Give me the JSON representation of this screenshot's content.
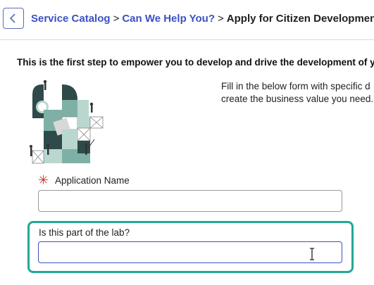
{
  "header": {
    "back_icon": "chevron-left-icon",
    "breadcrumb": {
      "items": [
        "Service Catalog",
        "Can We Help You?",
        "Apply for Citizen Development"
      ],
      "separator": ">"
    }
  },
  "intro_text": "This is the first step to empower you to develop and drive the development of your",
  "description": {
    "line1": "Fill in the below form with specific d",
    "line2": "create the business value you need."
  },
  "form": {
    "application_name": {
      "label": "Application Name",
      "required": true,
      "required_marker": "✳",
      "value": ""
    },
    "lab_part": {
      "label": "Is this part of the lab?",
      "value": ""
    }
  },
  "colors": {
    "link": "#3b50c4",
    "required": "#d0322f",
    "highlight": "#23a894",
    "focus_border": "#3b50c4",
    "illustration_dark": "#2f4a4a",
    "illustration_teal": "#7fb0a6",
    "illustration_pale": "#b9d7cf"
  }
}
